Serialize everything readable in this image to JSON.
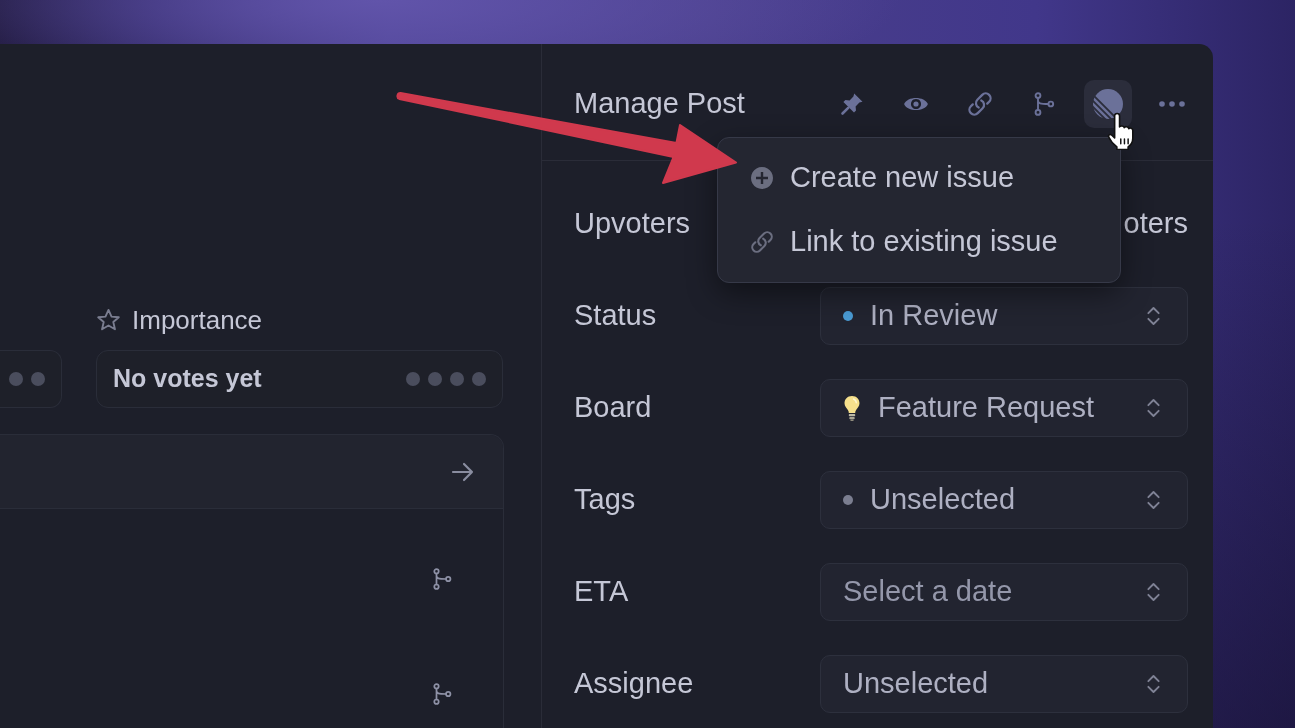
{
  "details": {
    "importance": {
      "label": "Importance",
      "value": "No votes yet"
    }
  },
  "manage_post": {
    "title": "Manage Post",
    "issue_button": {
      "expanded": true,
      "menu": [
        {
          "kind": "create",
          "label": "Create new issue"
        },
        {
          "kind": "link",
          "label": "Link to existing issue"
        }
      ]
    }
  },
  "fields": [
    {
      "kind": "text",
      "label": "Upvoters",
      "value": "oters"
    },
    {
      "kind": "dot",
      "label": "Status",
      "value": "In Review",
      "color": "#4a9bd4"
    },
    {
      "kind": "icon",
      "label": "Board",
      "value": "Feature Request"
    },
    {
      "kind": "dot",
      "label": "Tags",
      "value": "Unselected",
      "color": "#7b7e90"
    },
    {
      "kind": "plain",
      "label": "ETA",
      "placeholder": "Select a date"
    },
    {
      "kind": "plain",
      "label": "Assignee",
      "value": "Unselected"
    }
  ]
}
